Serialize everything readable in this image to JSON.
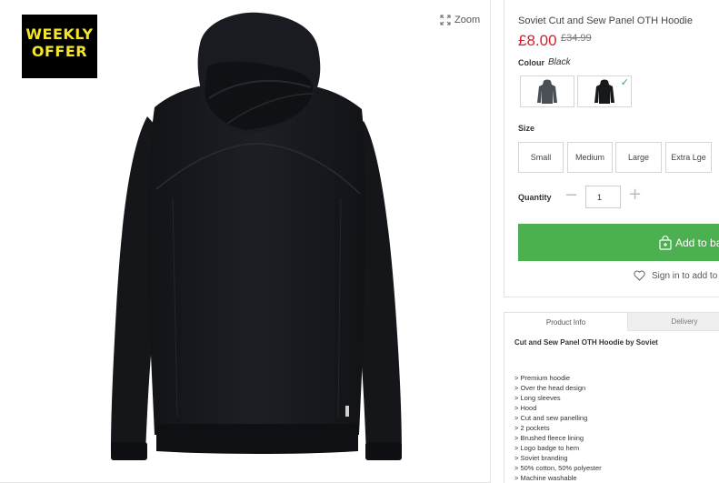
{
  "badge": {
    "line1": "WEEKLY",
    "line2": "OFFER"
  },
  "zoom_label": "Zoom",
  "product": {
    "title": "Soviet Cut and Sew Panel OTH Hoodie",
    "price": "£8.00",
    "was_price": "£34.99"
  },
  "colour": {
    "label": "Colour",
    "value": "Black",
    "swatches": [
      {
        "name": "Charcoal",
        "color": "#4a4f56",
        "selected": false
      },
      {
        "name": "Black",
        "color": "#16181c",
        "selected": true
      }
    ]
  },
  "size": {
    "label": "Size",
    "options": [
      "Small",
      "Medium",
      "Large",
      "Extra Lge"
    ]
  },
  "quantity": {
    "label": "Quantity",
    "value": "1"
  },
  "add_to_bag_label": "Add to ba",
  "signin_label": "Sign in to add to",
  "tabs": [
    "Product Info",
    "Delivery"
  ],
  "description_title": "Cut and Sew Panel OTH Hoodie by Soviet",
  "features": [
    "> Premium hoodie",
    "> Over the head design",
    "> Long sleeves",
    "> Hood",
    "> Cut and sew panelling",
    "> 2 pockets",
    "> Brushed fleece lining",
    "> Logo badge to hem",
    "> Soviet branding",
    "> 50% cotton, 50% polyester",
    "> Machine washable"
  ],
  "colors": {
    "price": "#d51d2a",
    "add_button": "#4caf50",
    "badge_bg": "#000000",
    "badge_text": "#f4e52b",
    "check": "#3aa94b"
  }
}
